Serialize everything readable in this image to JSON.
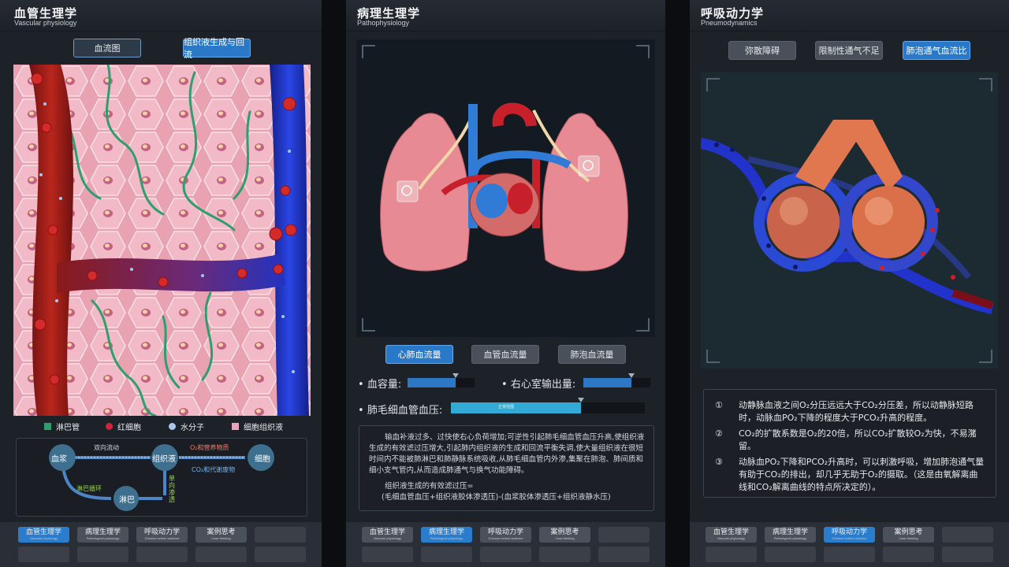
{
  "panels": [
    {
      "title": "血管生理学",
      "subtitle": "Vascular physiology",
      "buttons": [
        "血流图",
        "组织液生成与回流"
      ],
      "legend": [
        {
          "label": "淋巴管",
          "color": "#2e9e6d"
        },
        {
          "label": "红细胞",
          "color": "#d0243a"
        },
        {
          "label": "水分子",
          "color": "#a9c6ee"
        },
        {
          "label": "细胞组织液",
          "color": "#e6a3b9"
        }
      ],
      "diagram": {
        "nodes": [
          "血浆",
          "组织液",
          "细胞",
          "淋巴"
        ],
        "labels": {
          "bidirectional": "双向流动",
          "o2": "O₂和营养物质",
          "co2": "CO₂和代谢废物",
          "lymph_cycle": "淋巴循环",
          "one_way": "单向渗透"
        }
      }
    },
    {
      "title": "病理生理学",
      "subtitle": "Pathophysiology",
      "buttons": [
        "心肺血流量",
        "血管血流量",
        "肺泡血流量"
      ],
      "sliders": [
        {
          "label": "血容量:",
          "value": 0.72
        },
        {
          "label": "右心室输出量:",
          "value": 0.72
        },
        {
          "label": "肺毛细血管血压:",
          "value": 0.67,
          "tip": "正常范围"
        }
      ],
      "description": "输血补液过多、过快使右心负荷增加;可逆性引起肺毛细血管血压升高,使组织液生成的有效滤过压增大,引起肺内组织液的生成和回流平衡失调,使大量组织液在很短时间内不能被肺淋巴和肺静脉系统吸收,从肺毛细血管内外渗,集聚在肺泡、肺间质和细小支气管内,从而造成肺通气与换气功能障碍。",
      "formula_title": "组织液生成的有效滤过压=",
      "formula": "(毛细血管血压+组织液胶体渗透压)-(血浆胶体渗透压+组织液静水压)"
    },
    {
      "title": "呼吸动力学",
      "subtitle": "Pneumodynamics",
      "buttons": [
        "弥散障碍",
        "限制性通气不足",
        "肺泡通气血流比"
      ],
      "points": [
        {
          "num": "①",
          "text": "动静脉血液之间O₂分压远远大于CO₂分压差，所以动静脉短路时，动脉血PO₂下降的程度大于PCO₂升高的程度。"
        },
        {
          "num": "②",
          "text": "CO₂的扩散系数是O₂的20倍，所以CO₂扩散较O₂为快，不易潴留。"
        },
        {
          "num": "③",
          "text": "动脉血PO₂下降和PCO₂升高时，可以刺激呼吸，增加肺泡通气量有助于CO₂的排出，却几乎无助于O₂的摄取。（这是由氧解离曲线和CO₂解离曲线的特点所决定的）。"
        }
      ]
    }
  ],
  "nav": [
    {
      "label": "血管生理学",
      "sub": "Vascular physiology"
    },
    {
      "label": "病理生理学",
      "sub": "Pathological physiology"
    },
    {
      "label": "呼吸动力学",
      "sub": "Chinese herbal medicine"
    },
    {
      "label": "案例思考",
      "sub": "Case thinking"
    }
  ]
}
